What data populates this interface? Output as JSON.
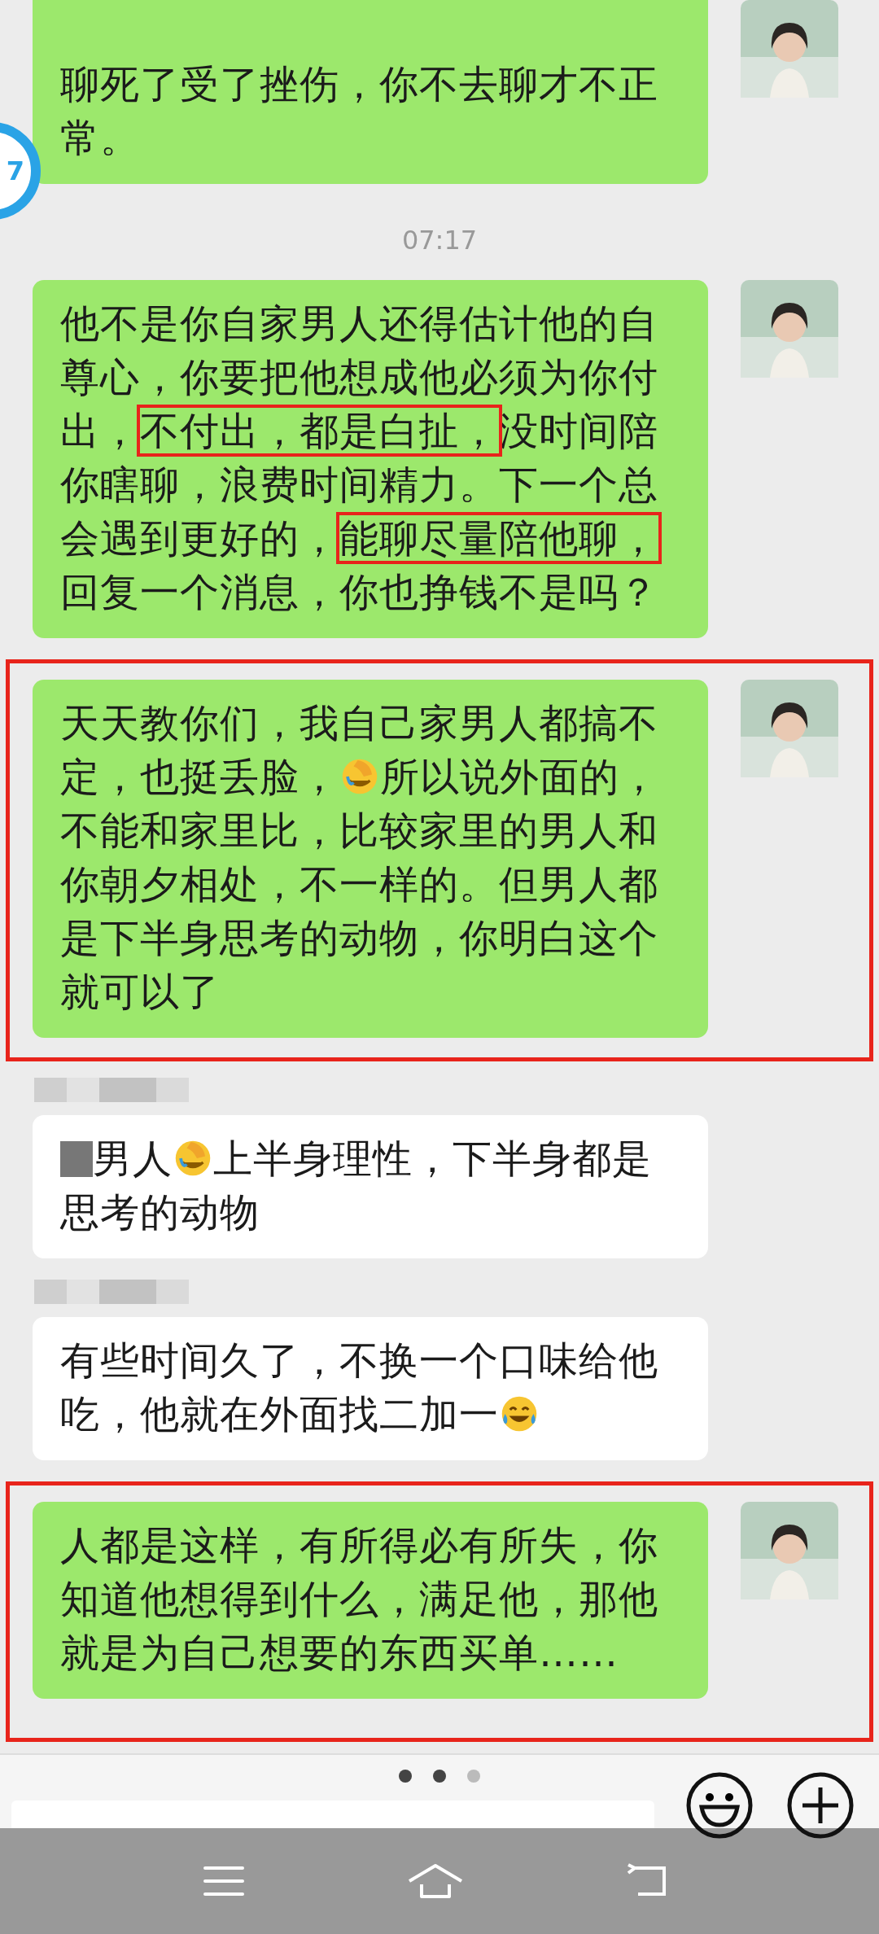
{
  "floating_badge": {
    "text": "7"
  },
  "chat": [
    {
      "kind": "message_out",
      "annotated": false,
      "cut_top": true,
      "segments": [
        {
          "kind": "text",
          "text": "聊死了受了挫伤，你不去聊才不正常。"
        }
      ]
    },
    {
      "kind": "time",
      "text": "07:17"
    },
    {
      "kind": "message_out",
      "annotated": false,
      "cut_top": false,
      "segments": [
        {
          "kind": "text",
          "text": "他不是你自家男人还得估计他的自尊心，你要把他想成他必须为你付出，"
        },
        {
          "kind": "boxed",
          "text": "不付出，都是白扯，"
        },
        {
          "kind": "text",
          "text": "没时间陪你瞎聊，浪费时间精力。下一个总会遇到更好的，"
        },
        {
          "kind": "boxed",
          "text": "能聊尽量陪他聊，"
        },
        {
          "kind": "text",
          "text": "回复一个消息，你也挣钱不是吗？"
        }
      ]
    },
    {
      "kind": "message_out",
      "annotated": true,
      "cut_top": false,
      "segments": [
        {
          "kind": "text",
          "text": "天天教你们，我自己家男人都搞不定，也挺丢脸，"
        },
        {
          "kind": "emoji_facepalm"
        },
        {
          "kind": "text",
          "text": "所以说外面的，不能和家里比，比较家里的男人和你朝夕相处，不一样的。但男人都是下半身思考的动物，你明白这个就可以了"
        }
      ]
    },
    {
      "kind": "message_in",
      "annotated": false,
      "cut_top": false,
      "segments": [
        {
          "kind": "blur"
        },
        {
          "kind": "text",
          "text": "男人"
        },
        {
          "kind": "emoji_facepalm"
        },
        {
          "kind": "text",
          "text": "上半身理性，下半身都是思考的动物"
        }
      ]
    },
    {
      "kind": "message_in",
      "annotated": false,
      "cut_top": false,
      "segments": [
        {
          "kind": "text",
          "text": "有些时间久了，不换一个口味给他吃，他就在外面找二加一"
        },
        {
          "kind": "emoji_joy"
        }
      ]
    },
    {
      "kind": "message_out",
      "annotated": true,
      "cut_top": false,
      "segments": [
        {
          "kind": "text",
          "text": "人都是这样，有所得必有所失，你知道他想得到什么，满足他，那他就是为自己想要的东西买单……"
        }
      ]
    }
  ],
  "page_dots": [
    {
      "selected": true
    },
    {
      "selected": true
    },
    {
      "selected": false
    }
  ]
}
